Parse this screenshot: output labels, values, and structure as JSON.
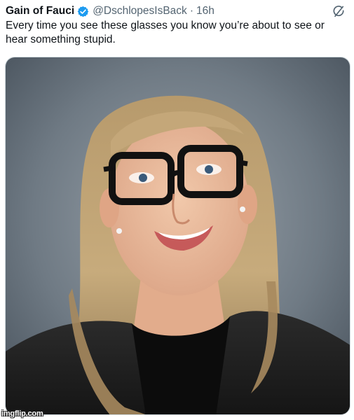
{
  "tweet": {
    "author_name": "Gain of Fauci",
    "author_handle": "@DschlopesIsBack",
    "separator": "·",
    "time": "16h",
    "text": "Every time you see these glasses you know you’re about to see or hear something stupid."
  },
  "media": {
    "alt_subject": "portrait photo",
    "watermark": "imgflip.com"
  },
  "colors": {
    "verified_badge": "#1d9bf0",
    "secondary_text": "#536471",
    "primary_text": "#0f1419"
  },
  "icons": {
    "verified": "verified-badge-icon",
    "grok": "grok-icon"
  }
}
